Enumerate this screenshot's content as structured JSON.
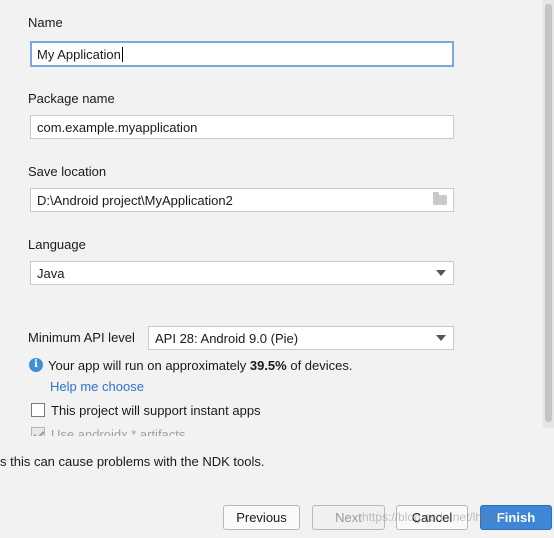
{
  "form": {
    "name_label": "Name",
    "name_value": "My Application",
    "package_label": "Package name",
    "package_value": "com.example.myapplication",
    "save_label": "Save location",
    "save_value": "D:\\Android project\\MyApplication2",
    "language_label": "Language",
    "language_value": "Java",
    "min_api_label": "Minimum API level",
    "min_api_value": "API 28: Android 9.0 (Pie)"
  },
  "info": {
    "prefix": "Your app will run on approximately ",
    "percent": "39.5%",
    "suffix": " of devices.",
    "help_link": "Help me choose"
  },
  "options": {
    "instant_apps_label": "This project will support instant apps",
    "instant_apps_checked": false,
    "androidx_label": "Use androidx.* artifacts",
    "androidx_checked": true
  },
  "warning": "s this can cause problems with the NDK tools.",
  "buttons": {
    "previous": "Previous",
    "next": "Next",
    "cancel": "Cancel",
    "finish": "Finish"
  },
  "watermark": "https://blog.csdn.net/lhp1ll",
  "colors": {
    "link": "#2f73c9",
    "info_icon": "#3f8fd6",
    "primary_button": "#3d87d6",
    "focus_border": "#7aa7de"
  }
}
